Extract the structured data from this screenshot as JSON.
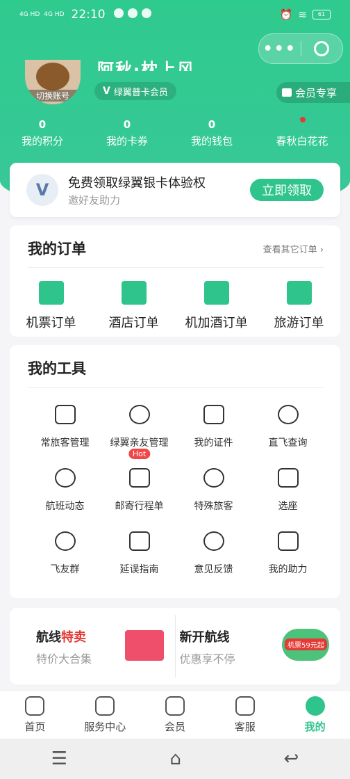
{
  "status_bar": {
    "signal1": "4G HD",
    "signal2": "4G HD",
    "time": "22:10",
    "battery": "61"
  },
  "capsule": {
    "more": "•••",
    "close_icon": "target-circle-icon"
  },
  "profile": {
    "avatar_switch": "切换账号",
    "username": "阿秋·枕上风",
    "member_level": "绿翼普卡会员",
    "vip_label": "会员专享"
  },
  "stats": [
    {
      "value": "0",
      "label": "我的积分"
    },
    {
      "value": "0",
      "label": "我的卡券"
    },
    {
      "value": "0",
      "label": "我的钱包"
    },
    {
      "value": "",
      "label": "春秋白花花"
    }
  ],
  "promo": {
    "title": "免费领取绿翼银卡体验权",
    "subtitle": "邀好友助力",
    "button": "立即领取"
  },
  "orders": {
    "title": "我的订单",
    "more": "查看其它订单",
    "items": [
      "机票订单",
      "酒店订单",
      "机加酒订单",
      "旅游订单"
    ]
  },
  "tools": {
    "title": "我的工具",
    "hot_badge": "Hot",
    "items": [
      "常旅客管理",
      "绿翼亲友管理",
      "我的证件",
      "直飞查询",
      "航班动态",
      "邮寄行程单",
      "特殊旅客",
      "选座",
      "飞友群",
      "延误指南",
      "意见反馈",
      "我的助力"
    ]
  },
  "banners": {
    "left_title_a": "航线",
    "left_title_b": "特卖",
    "left_sub": "特价大合集",
    "right_title": "新开航线",
    "right_sub": "优惠享不停",
    "right_tag": "机票59元起"
  },
  "tabbar": [
    "首页",
    "服务中心",
    "会员",
    "客服",
    "我的"
  ],
  "accent_color": "#2ec48b"
}
